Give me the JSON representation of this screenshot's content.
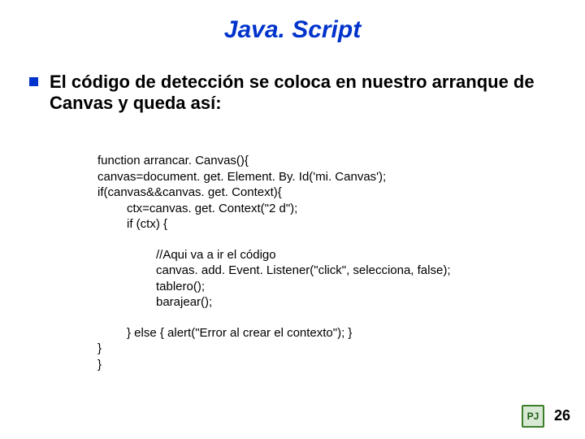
{
  "title": "Java. Script",
  "bullet": "El código de detección se coloca en nuestro arranque de Canvas y queda así:",
  "code": {
    "l1": "function arrancar. Canvas(){",
    "l2": "canvas=document. get. Element. By. Id('mi. Canvas');",
    "l3": "if(canvas&&canvas. get. Context){",
    "l4": "ctx=canvas. get. Context(\"2 d\");",
    "l5": "if (ctx) {",
    "l6": "//Aqui va a ir el código",
    "l7": "canvas. add. Event. Listener(\"click\", selecciona, false);",
    "l8": "tablero();",
    "l9": "barajear();",
    "l10": "} else { alert(\"Error al crear el contexto\"); }",
    "l11": "}",
    "l12": "}"
  },
  "page_number": "26",
  "footer_icon_label": "PJ"
}
